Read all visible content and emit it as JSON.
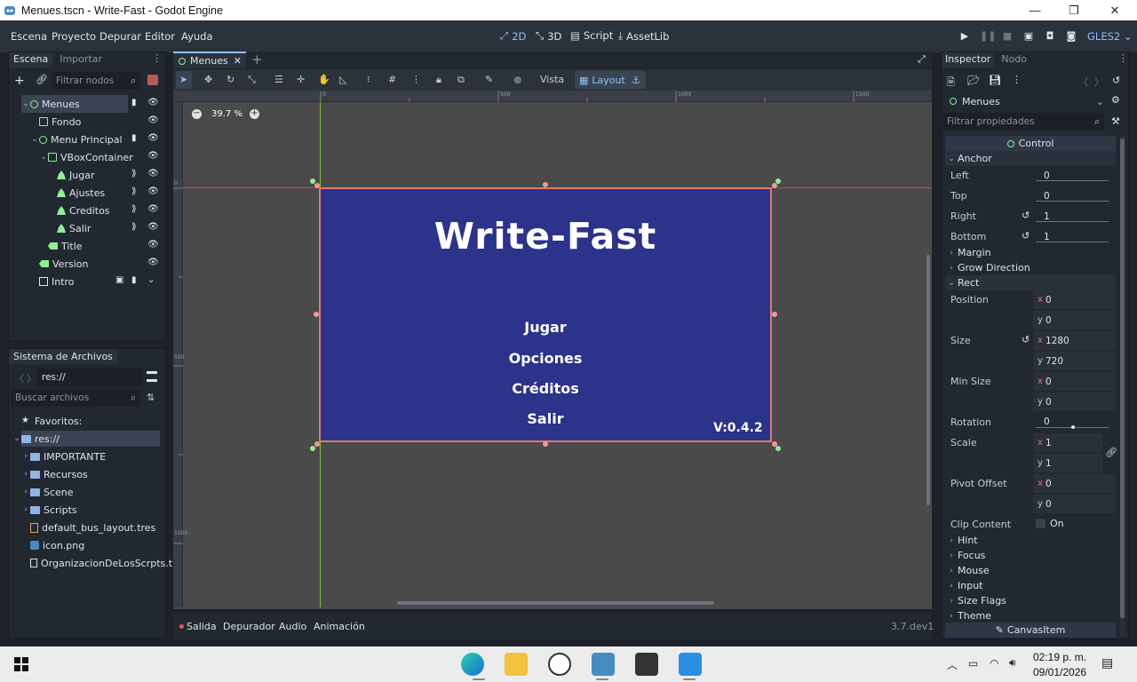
{
  "window": {
    "title": "Menues.tscn - Write-Fast - Godot Engine",
    "controls": [
      "—",
      "❐",
      "✕"
    ]
  },
  "menubar": {
    "items": [
      "Escena",
      "Proyecto",
      "Depurar",
      "Editor",
      "Ayuda"
    ],
    "workspaces": [
      {
        "label": "2D",
        "active": true
      },
      {
        "label": "3D",
        "active": false
      },
      {
        "label": "Script",
        "active": false
      },
      {
        "label": "AssetLib",
        "active": false
      }
    ],
    "renderer": "GLES2"
  },
  "scene_dock": {
    "tabs": [
      "Escena",
      "Importar"
    ],
    "filter_placeholder": "Filtrar nodos",
    "nodes": [
      {
        "name": "Menues",
        "icon": "control-icon",
        "selected": true
      },
      {
        "name": "Fondo",
        "icon": "color-rect-icon"
      },
      {
        "name": "Menu Principal",
        "icon": "control-icon"
      },
      {
        "name": "VBoxContainer",
        "icon": "vbox-icon"
      },
      {
        "name": "Jugar",
        "icon": "button-icon"
      },
      {
        "name": "Ajustes",
        "icon": "button-icon"
      },
      {
        "name": "Creditos",
        "icon": "button-icon"
      },
      {
        "name": "Salir",
        "icon": "button-icon"
      },
      {
        "name": "Title",
        "icon": "label-icon"
      },
      {
        "name": "Version",
        "icon": "label-icon"
      },
      {
        "name": "Intro",
        "icon": "video-player-icon"
      }
    ]
  },
  "filesystem_dock": {
    "title": "Sistema de Archivos",
    "path": "res://",
    "search_placeholder": "Buscar archivos",
    "items": [
      {
        "name": "Favoritos:",
        "icon": "star-icon"
      },
      {
        "name": "res://",
        "icon": "folder-icon",
        "selected": true
      },
      {
        "name": "IMPORTANTE",
        "icon": "folder-icon"
      },
      {
        "name": "Recursos",
        "icon": "folder-icon"
      },
      {
        "name": "Scene",
        "icon": "folder-icon"
      },
      {
        "name": "Scripts",
        "icon": "folder-icon"
      },
      {
        "name": "default_bus_layout.tres",
        "icon": "audio-bus-icon"
      },
      {
        "name": "icon.png",
        "icon": "image-icon"
      },
      {
        "name": "OrganizacionDeLosScrpts.t",
        "icon": "file-icon"
      }
    ]
  },
  "editor": {
    "tab": "Menues",
    "zoom": "39.7 %",
    "toolbar": {
      "view": "Vista",
      "layout": "Layout"
    },
    "ruler_labels": [
      "0",
      "500",
      "1000",
      "1500"
    ],
    "ruler_v_labels": [
      "0",
      "500",
      "1000"
    ],
    "canvas": {
      "title": "Write-Fast",
      "buttons": [
        "Jugar",
        "Opciones",
        "Créditos",
        "Salir"
      ],
      "version": "V:0.4.2",
      "bg": "#2b338a",
      "border": "#e0796d"
    }
  },
  "bottom_panel": {
    "tabs": [
      "Salida",
      "Depurador",
      "Audio",
      "Animación"
    ],
    "version": "3.7.dev1"
  },
  "inspector": {
    "tabs": [
      "Inspector",
      "Nodo"
    ],
    "node_name": "Menues",
    "filter_placeholder": "Filtrar propiedades",
    "class_name": "Control",
    "anchor": {
      "title": "Anchor",
      "left_label": "Left",
      "left": "0",
      "top_label": "Top",
      "top": "0",
      "right_label": "Right",
      "right": "1",
      "bottom_label": "Bottom",
      "bottom": "1"
    },
    "sections_mid": [
      "Margin",
      "Grow Direction"
    ],
    "rect": {
      "title": "Rect",
      "position_label": "Position",
      "pos_x": "0",
      "pos_y": "0",
      "size_label": "Size",
      "size_x": "1280",
      "size_y": "720",
      "min_size_label": "Min Size",
      "min_x": "0",
      "min_y": "0",
      "rotation_label": "Rotation",
      "rotation": "0",
      "scale_label": "Scale",
      "scale_x": "1",
      "scale_y": "1",
      "pivot_label": "Pivot Offset",
      "pivot_x": "0",
      "pivot_y": "0",
      "clip_label": "Clip Content",
      "clip_value": "On"
    },
    "sections_bottom": [
      "Hint",
      "Focus",
      "Mouse",
      "Input",
      "Size Flags",
      "Theme"
    ],
    "footer": "CanvasItem"
  },
  "taskbar": {
    "time": "02:19 p. m.",
    "date": "09/01/2026"
  }
}
